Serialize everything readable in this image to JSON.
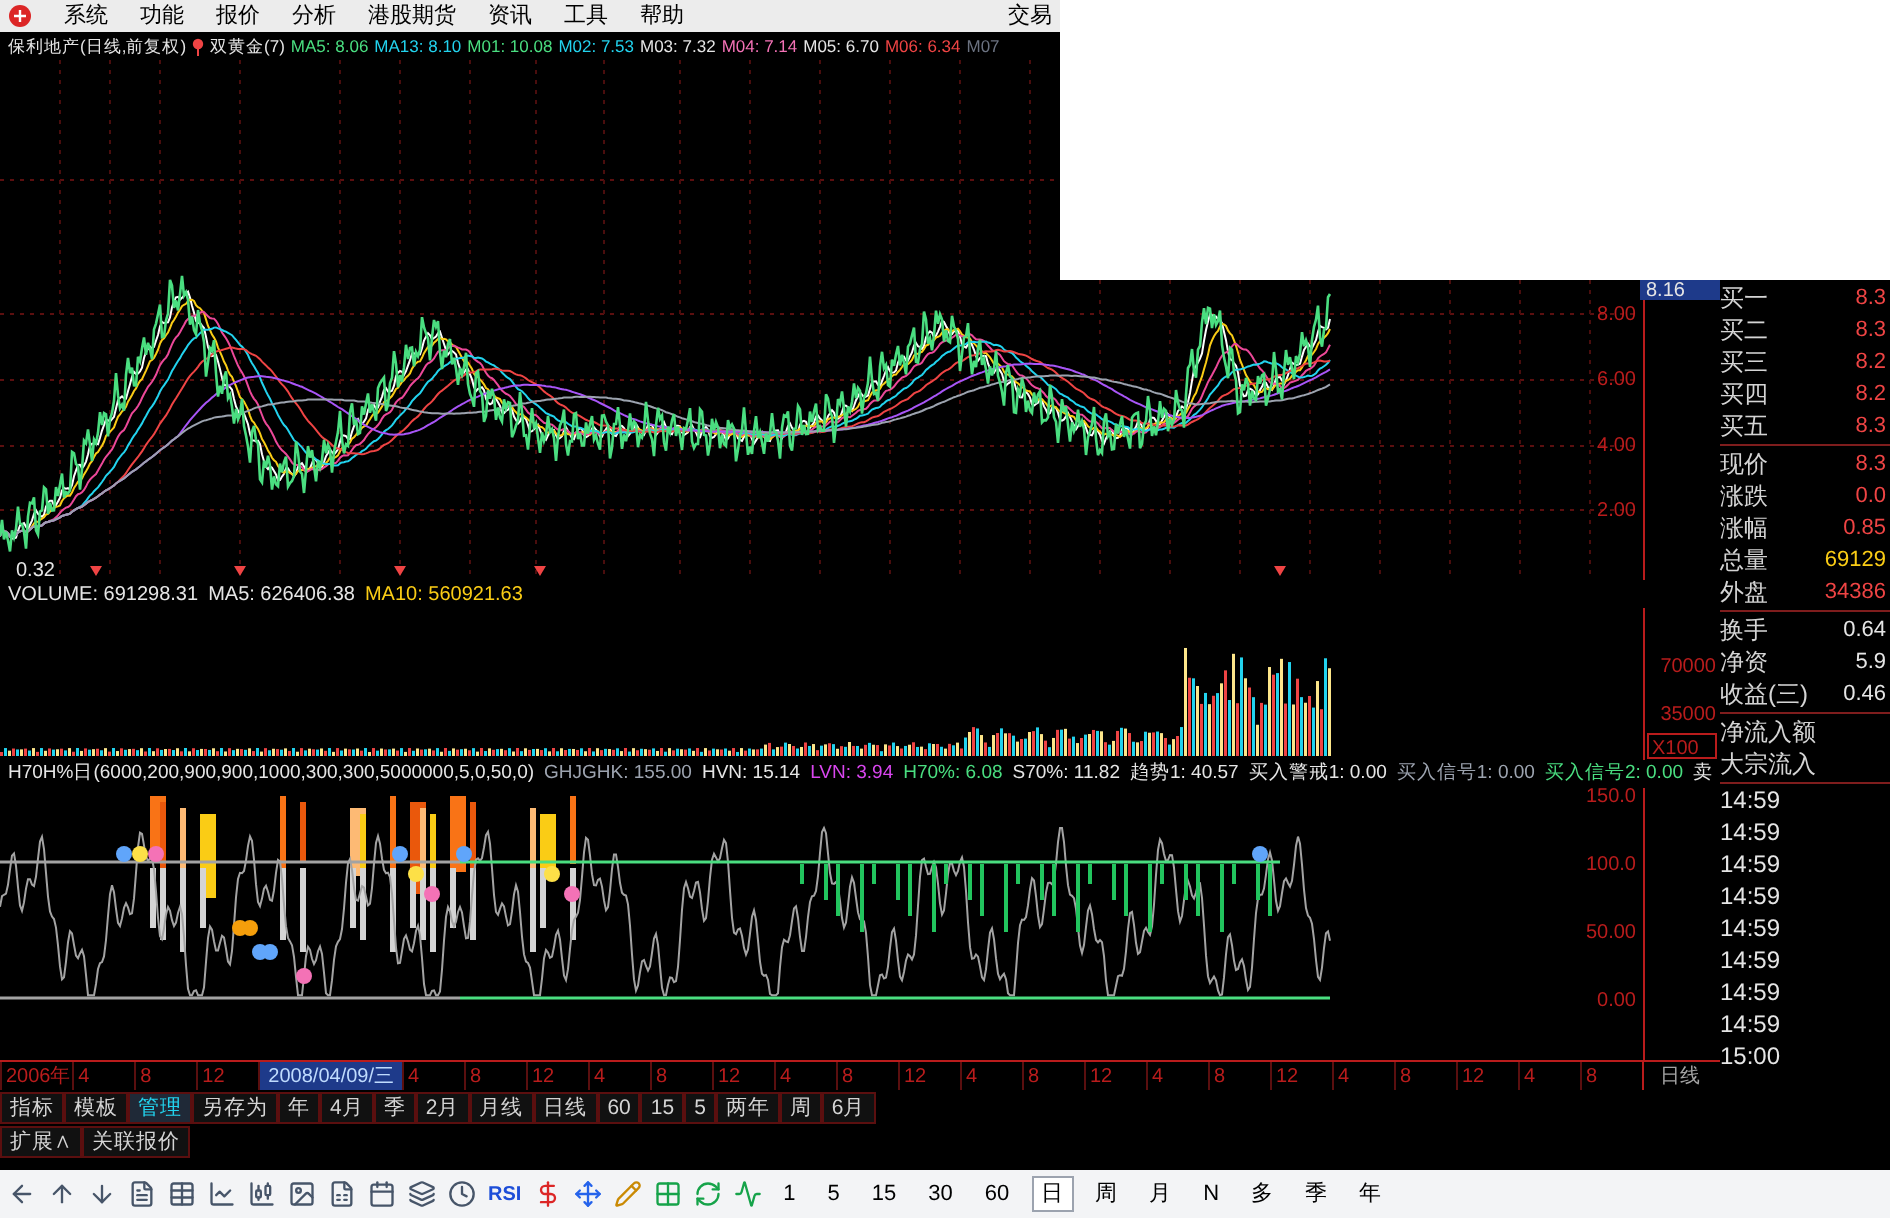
{
  "menu_bar": {
    "items": [
      "系统",
      "功能",
      "报价",
      "分析",
      "港股期货",
      "资讯",
      "工具",
      "帮助"
    ],
    "right_item": "交易"
  },
  "title_bar": {
    "stock": "保利地产(日线,前复权)",
    "indicator": "双黄金(7)",
    "values": [
      {
        "text": "MA5: 8.06",
        "color": "#4ade80"
      },
      {
        "text": "MA13: 8.10",
        "color": "#22d3ee"
      },
      {
        "text": "M01: 10.08",
        "color": "#4ade80"
      },
      {
        "text": "M02: 7.53",
        "color": "#22d3ee"
      },
      {
        "text": "M03: 7.32",
        "color": "#e5e5e5"
      },
      {
        "text": "M04: 7.14",
        "color": "#f472b6"
      },
      {
        "text": "M05: 6.70",
        "color": "#e5e5e5"
      },
      {
        "text": "M06: 6.34",
        "color": "#ef4444"
      },
      {
        "text": "M07",
        "color": "#6b7280"
      }
    ]
  },
  "price_chart": {
    "low_label": "0.32",
    "last_price_tag": "8.16",
    "axis_labels": [
      "8.00",
      "6.00",
      "4.00",
      "2.00"
    ]
  },
  "volume_chart": {
    "values": [
      {
        "text": "VOLUME: 691298.31",
        "color": "#e5e5e5"
      },
      {
        "text": "MA5: 626406.38",
        "color": "#e5e5e5"
      },
      {
        "text": "MA10: 560921.63",
        "color": "#facc15"
      }
    ],
    "axis_labels": [
      "70000",
      "35000"
    ],
    "scale_label": "X100"
  },
  "indicator_chart": {
    "values": [
      {
        "text": "H70H%日(6000,200,900,900,1000,300,300,5000000,5,0,50,0)",
        "color": "#e5e5e5"
      },
      {
        "text": "GHJGHK: 155.00",
        "color": "#9ca3af"
      },
      {
        "text": "HVN: 15.14",
        "color": "#e5e5e5"
      },
      {
        "text": "LVN: 3.94",
        "color": "#d946ef"
      },
      {
        "text": "H70%: 6.08",
        "color": "#4ade80"
      },
      {
        "text": "S70%: 11.82",
        "color": "#e5e5e5"
      },
      {
        "text": "趋势1: 40.57",
        "color": "#e5e5e5"
      },
      {
        "text": "买入警戒1: 0.00",
        "color": "#e5e5e5"
      },
      {
        "text": "买入信号1: 0.00",
        "color": "#9ca3af"
      },
      {
        "text": "买入信号2: 0.00",
        "color": "#4ade80"
      },
      {
        "text": "卖",
        "color": "#e5e5e5"
      }
    ],
    "axis_labels": [
      "150.0",
      "100.0",
      "50.00",
      "0.00"
    ],
    "period_label": "日线"
  },
  "quote_panel": {
    "groups": [
      [
        {
          "label": "买一",
          "value": "8.3",
          "color": "#ef4444"
        },
        {
          "label": "买二",
          "value": "8.3",
          "color": "#ef4444"
        },
        {
          "label": "买三",
          "value": "8.2",
          "color": "#ef4444"
        },
        {
          "label": "买四",
          "value": "8.2",
          "color": "#ef4444"
        },
        {
          "label": "买五",
          "value": "8.3",
          "color": "#ef4444"
        }
      ],
      [
        {
          "label": "现价",
          "value": "8.3",
          "color": "#ef4444"
        },
        {
          "label": "涨跌",
          "value": "0.0",
          "color": "#ef4444"
        },
        {
          "label": "涨幅",
          "value": "0.85",
          "color": "#ef4444"
        },
        {
          "label": "总量",
          "value": "69129",
          "color": "#facc15"
        },
        {
          "label": "外盘",
          "value": "34386",
          "color": "#ef4444"
        }
      ],
      [
        {
          "label": "换手",
          "value": "0.64",
          "color": "#e5e5e5"
        },
        {
          "label": "净资",
          "value": "5.9",
          "color": "#e5e5e5"
        },
        {
          "label": "收益(三)",
          "value": "0.46",
          "color": "#e5e5e5"
        }
      ],
      [
        {
          "label": "净流入额"
        },
        {
          "label": "大宗流入"
        }
      ]
    ],
    "times": [
      "14:59",
      "14:59",
      "14:59",
      "14:59",
      "14:59",
      "14:59",
      "14:59",
      "14:59",
      "15:00"
    ]
  },
  "date_axis": [
    {
      "text": "2006年",
      "selected": false
    },
    {
      "text": "4",
      "selected": false
    },
    {
      "text": "8",
      "selected": false
    },
    {
      "text": "12",
      "selected": false
    },
    {
      "text": "2008/04/09/三",
      "selected": true
    },
    {
      "text": "4",
      "selected": false
    },
    {
      "text": "8",
      "selected": false
    },
    {
      "text": "12",
      "selected": false
    },
    {
      "text": "4",
      "selected": false
    },
    {
      "text": "8",
      "selected": false
    },
    {
      "text": "12",
      "selected": false
    },
    {
      "text": "4",
      "selected": false
    },
    {
      "text": "8",
      "selected": false
    },
    {
      "text": "12",
      "selected": false
    },
    {
      "text": "4",
      "selected": false
    },
    {
      "text": "8",
      "selected": false
    },
    {
      "text": "12",
      "selected": false
    },
    {
      "text": "4",
      "selected": false
    },
    {
      "text": "8",
      "selected": false
    },
    {
      "text": "12",
      "selected": false
    },
    {
      "text": "4",
      "selected": false
    },
    {
      "text": "8",
      "selected": false
    },
    {
      "text": "12",
      "selected": false
    },
    {
      "text": "4",
      "selected": false
    },
    {
      "text": "8",
      "selected": false
    }
  ],
  "period_tabs": [
    {
      "label": "指标",
      "selected": false
    },
    {
      "label": "模板",
      "selected": false
    },
    {
      "label": "管理",
      "selected": true
    },
    {
      "label": "另存为",
      "selected": false
    },
    {
      "label": "年",
      "selected": false
    },
    {
      "label": "4月",
      "selected": false
    },
    {
      "label": "季",
      "selected": false
    },
    {
      "label": "2月",
      "selected": false
    },
    {
      "label": "月线",
      "selected": false
    },
    {
      "label": "日线",
      "selected": false
    },
    {
      "label": "60",
      "selected": false
    },
    {
      "label": "15",
      "selected": false
    },
    {
      "label": "5",
      "selected": false
    },
    {
      "label": "两年",
      "selected": false
    },
    {
      "label": "周",
      "selected": false
    },
    {
      "label": "6月",
      "selected": false
    }
  ],
  "secondary_tabs": [
    "扩展∧",
    "关联报价"
  ],
  "toolbar": {
    "indicator_label": "RSI",
    "periods": [
      {
        "label": "1",
        "selected": false
      },
      {
        "label": "5",
        "selected": false
      },
      {
        "label": "15",
        "selected": false
      },
      {
        "label": "30",
        "selected": false
      },
      {
        "label": "60",
        "selected": false
      },
      {
        "label": "日",
        "selected": true
      },
      {
        "label": "周",
        "selected": false
      },
      {
        "label": "月",
        "selected": false
      },
      {
        "label": "N",
        "selected": false
      },
      {
        "label": "多",
        "selected": false
      },
      {
        "label": "季",
        "selected": false
      },
      {
        "label": "年",
        "selected": false
      }
    ]
  }
}
